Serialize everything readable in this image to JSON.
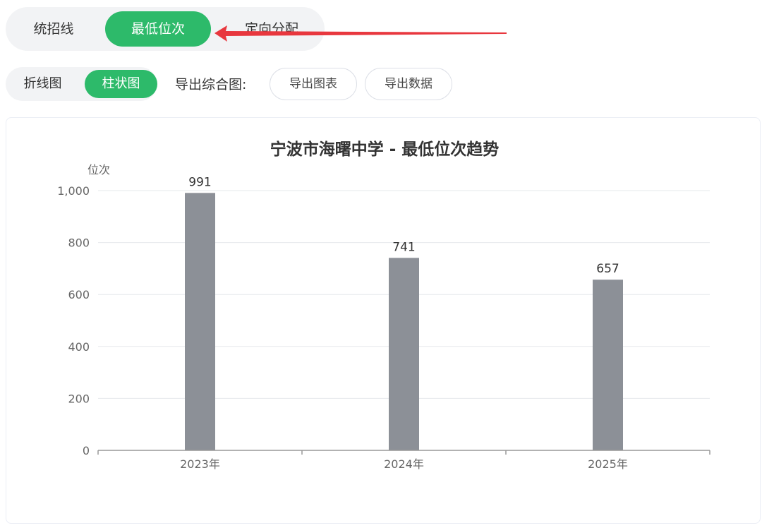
{
  "top_tabs": [
    {
      "label": "统招线",
      "active": false
    },
    {
      "label": "最低位次",
      "active": true
    },
    {
      "label": "定向分配",
      "active": false
    }
  ],
  "chart_tabs": [
    {
      "label": "折线图",
      "active": false
    },
    {
      "label": "柱状图",
      "active": true
    }
  ],
  "export": {
    "label": "导出综合图:",
    "chart_button": "导出图表",
    "data_button": "导出数据"
  },
  "colors": {
    "accent": "#2dba6a",
    "bar": "#8c9097",
    "arrow": "#e8373e"
  },
  "chart_data": {
    "type": "bar",
    "title": "宁波市海曙中学 - 最低位次趋势",
    "ylabel": "位次",
    "xlabel": "",
    "categories": [
      "2023年",
      "2024年",
      "2025年"
    ],
    "values": [
      991,
      741,
      657
    ],
    "ylim": [
      0,
      1000
    ],
    "yticks": [
      0,
      200,
      400,
      600,
      800,
      1000
    ],
    "ytick_labels": [
      "0",
      "200",
      "400",
      "600",
      "800",
      "1,000"
    ],
    "grid": true
  }
}
